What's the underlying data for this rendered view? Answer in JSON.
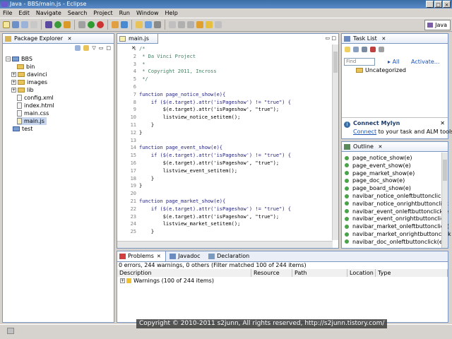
{
  "window": {
    "title": "Java - BBS/main.js - Eclipse",
    "controls": [
      "_",
      "□",
      "×"
    ]
  },
  "menu": [
    "File",
    "Edit",
    "Navigate",
    "Search",
    "Project",
    "Run",
    "Window",
    "Help"
  ],
  "perspective": {
    "label": "Java"
  },
  "package_explorer": {
    "tab_label": "Package Explorer",
    "items": [
      {
        "label": "BBS",
        "kind": "project",
        "level": 0
      },
      {
        "label": "bin",
        "kind": "folder",
        "level": 1
      },
      {
        "label": "davinci",
        "kind": "folder",
        "level": 1
      },
      {
        "label": "images",
        "kind": "folder",
        "level": 1
      },
      {
        "label": "lib",
        "kind": "folder",
        "level": 1
      },
      {
        "label": "config.xml",
        "kind": "file",
        "level": 1
      },
      {
        "label": "index.html",
        "kind": "file",
        "level": 1
      },
      {
        "label": "main.css",
        "kind": "file",
        "level": 1
      },
      {
        "label": "main.js",
        "kind": "file",
        "level": 1,
        "selected": true
      },
      {
        "label": "test",
        "kind": "project",
        "level": 0
      }
    ]
  },
  "editor": {
    "tab_label": "main.js",
    "lines": [
      {
        "n": "1",
        "text": "/*",
        "type": "cmt"
      },
      {
        "n": "2",
        "text": " * Da Vinci Project",
        "type": "cmt"
      },
      {
        "n": "3",
        "text": " *",
        "type": "cmt"
      },
      {
        "n": "4",
        "text": " * Copyright 2011, Incross",
        "type": "cmt"
      },
      {
        "n": "5",
        "text": " */",
        "type": "cmt"
      },
      {
        "n": "6",
        "text": "",
        "type": "plain"
      },
      {
        "n": "7",
        "text": "function page_notice_show(e){",
        "type": "fn"
      },
      {
        "n": "8",
        "text": "    if ($(e.target).attr('isPageshow') != \"true\") {",
        "type": "if"
      },
      {
        "n": "9",
        "text": "        $(e.target).attr('isPageshow', \"true\");",
        "type": "plain"
      },
      {
        "n": "10",
        "text": "        listview_notice_setitem();",
        "type": "plain"
      },
      {
        "n": "11",
        "text": "    }",
        "type": "plain"
      },
      {
        "n": "12",
        "text": "}",
        "type": "plain"
      },
      {
        "n": "13",
        "text": "",
        "type": "plain"
      },
      {
        "n": "14",
        "text": "function page_event_show(e){",
        "type": "fn"
      },
      {
        "n": "15",
        "text": "    if ($(e.target).attr('isPageshow') != \"true\") {",
        "type": "if"
      },
      {
        "n": "16",
        "text": "        $(e.target).attr('isPageshow', \"true\");",
        "type": "plain"
      },
      {
        "n": "17",
        "text": "        listview_event_setitem();",
        "type": "plain"
      },
      {
        "n": "18",
        "text": "    }",
        "type": "plain"
      },
      {
        "n": "19",
        "text": "}",
        "type": "plain"
      },
      {
        "n": "20",
        "text": "",
        "type": "plain"
      },
      {
        "n": "21",
        "text": "function page_market_show(e){",
        "type": "fn"
      },
      {
        "n": "22",
        "text": "    if ($(e.target).attr('isPageshow') != \"true\") {",
        "type": "if"
      },
      {
        "n": "23",
        "text": "        $(e.target).attr('isPageshow', \"true\");",
        "type": "plain"
      },
      {
        "n": "24",
        "text": "        listview_market_setitem();",
        "type": "plain"
      },
      {
        "n": "25",
        "text": "    }",
        "type": "plain"
      }
    ]
  },
  "task_list": {
    "tab_label": "Task List",
    "find_placeholder": "Find",
    "all_label": "All",
    "activate_label": "Activate...",
    "category": "Uncategorized"
  },
  "mylyn": {
    "title": "Connect Mylyn",
    "link": "Connect",
    "text": "to your task and ALM tools,"
  },
  "outline": {
    "tab_label": "Outline",
    "items": [
      "page_notice_show(e)",
      "page_event_show(e)",
      "page_market_show(e)",
      "page_doc_show(e)",
      "page_board_show(e)",
      "navibar_notice_onleftbuttonclick(",
      "navibar_notice_onrightbuttonclick",
      "navibar_event_onleftbuttonclick(e",
      "navibar_event_onrightbuttonclick",
      "navibar_market_onleftbuttonclick(",
      "navibar_market_onrightbuttonclick",
      "navibar_doc_onleftbuttonclick(e)"
    ]
  },
  "problems": {
    "tabs": [
      "Problems",
      "Javadoc",
      "Declaration"
    ],
    "summary": "0 errors, 244 warnings, 0 others (Filter matched 100 of 244 items)",
    "columns": [
      "Description",
      "Resource",
      "Path",
      "Location",
      "Type"
    ],
    "rows": [
      {
        "description": "Warnings (100 of 244 items)"
      }
    ]
  },
  "copyright": "Copyright © 2010-2011 s2junn, All rights reserved, http://s2junn.tistory.com/"
}
